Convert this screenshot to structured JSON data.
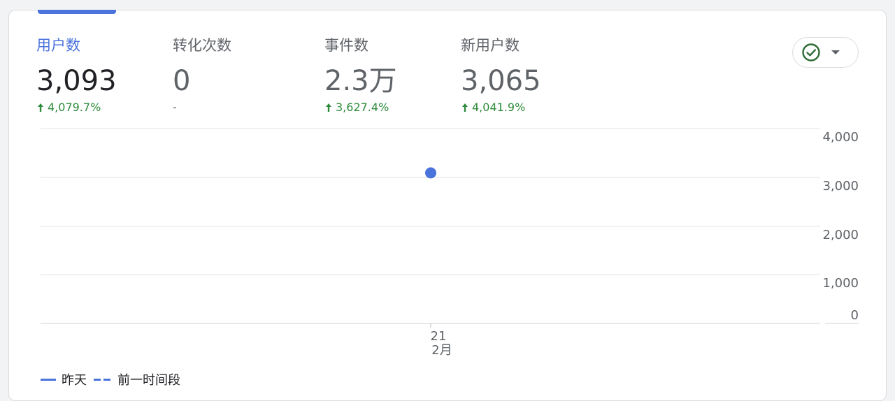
{
  "metrics": [
    {
      "label": "用户数",
      "value": "3,093",
      "change": "4,079.7%",
      "trend": "up"
    },
    {
      "label": "转化次数",
      "value": "0",
      "change": "-",
      "trend": "none"
    },
    {
      "label": "事件数",
      "value": "2.3万",
      "change": "3,627.4%",
      "trend": "up"
    },
    {
      "label": "新用户数",
      "value": "3,065",
      "change": "4,041.9%",
      "trend": "up"
    }
  ],
  "compare_control": {
    "icon": "check-circle-icon",
    "dropdown_icon": "caret-down-icon"
  },
  "colors": {
    "accent": "#4a73dc",
    "positive": "#2e8b3a",
    "muted": "#5f6368",
    "grid": "#e0e0e0"
  },
  "chart_data": {
    "type": "line",
    "x": [
      "21"
    ],
    "x_sublabel": "2月",
    "series": [
      {
        "name": "昨天",
        "values": [
          3093
        ]
      }
    ],
    "ylim": [
      0,
      4000
    ],
    "yticks": [
      "4,000",
      "3,000",
      "2,000",
      "1,000",
      "0"
    ],
    "ytick_values": [
      4000,
      3000,
      2000,
      1000,
      0
    ],
    "grid": true
  },
  "legend": {
    "items": [
      "昨天",
      "前一时间段"
    ]
  }
}
